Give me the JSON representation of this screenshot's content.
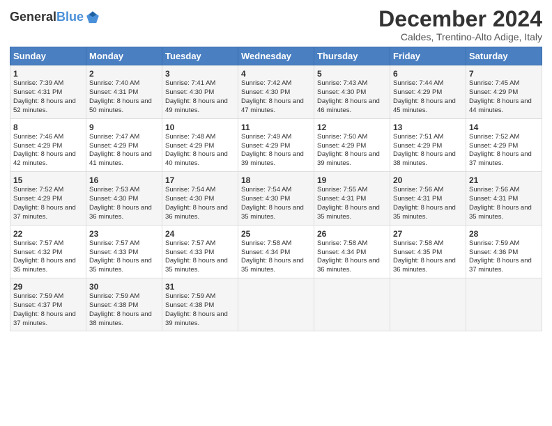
{
  "logo": {
    "line1": "General",
    "line2": "Blue"
  },
  "title": "December 2024",
  "location": "Caldes, Trentino-Alto Adige, Italy",
  "days_header": [
    "Sunday",
    "Monday",
    "Tuesday",
    "Wednesday",
    "Thursday",
    "Friday",
    "Saturday"
  ],
  "weeks": [
    [
      {
        "day": "1",
        "sunrise": "Sunrise: 7:39 AM",
        "sunset": "Sunset: 4:31 PM",
        "daylight": "Daylight: 8 hours and 52 minutes."
      },
      {
        "day": "2",
        "sunrise": "Sunrise: 7:40 AM",
        "sunset": "Sunset: 4:31 PM",
        "daylight": "Daylight: 8 hours and 50 minutes."
      },
      {
        "day": "3",
        "sunrise": "Sunrise: 7:41 AM",
        "sunset": "Sunset: 4:30 PM",
        "daylight": "Daylight: 8 hours and 49 minutes."
      },
      {
        "day": "4",
        "sunrise": "Sunrise: 7:42 AM",
        "sunset": "Sunset: 4:30 PM",
        "daylight": "Daylight: 8 hours and 47 minutes."
      },
      {
        "day": "5",
        "sunrise": "Sunrise: 7:43 AM",
        "sunset": "Sunset: 4:30 PM",
        "daylight": "Daylight: 8 hours and 46 minutes."
      },
      {
        "day": "6",
        "sunrise": "Sunrise: 7:44 AM",
        "sunset": "Sunset: 4:29 PM",
        "daylight": "Daylight: 8 hours and 45 minutes."
      },
      {
        "day": "7",
        "sunrise": "Sunrise: 7:45 AM",
        "sunset": "Sunset: 4:29 PM",
        "daylight": "Daylight: 8 hours and 44 minutes."
      }
    ],
    [
      {
        "day": "8",
        "sunrise": "Sunrise: 7:46 AM",
        "sunset": "Sunset: 4:29 PM",
        "daylight": "Daylight: 8 hours and 42 minutes."
      },
      {
        "day": "9",
        "sunrise": "Sunrise: 7:47 AM",
        "sunset": "Sunset: 4:29 PM",
        "daylight": "Daylight: 8 hours and 41 minutes."
      },
      {
        "day": "10",
        "sunrise": "Sunrise: 7:48 AM",
        "sunset": "Sunset: 4:29 PM",
        "daylight": "Daylight: 8 hours and 40 minutes."
      },
      {
        "day": "11",
        "sunrise": "Sunrise: 7:49 AM",
        "sunset": "Sunset: 4:29 PM",
        "daylight": "Daylight: 8 hours and 39 minutes."
      },
      {
        "day": "12",
        "sunrise": "Sunrise: 7:50 AM",
        "sunset": "Sunset: 4:29 PM",
        "daylight": "Daylight: 8 hours and 39 minutes."
      },
      {
        "day": "13",
        "sunrise": "Sunrise: 7:51 AM",
        "sunset": "Sunset: 4:29 PM",
        "daylight": "Daylight: 8 hours and 38 minutes."
      },
      {
        "day": "14",
        "sunrise": "Sunrise: 7:52 AM",
        "sunset": "Sunset: 4:29 PM",
        "daylight": "Daylight: 8 hours and 37 minutes."
      }
    ],
    [
      {
        "day": "15",
        "sunrise": "Sunrise: 7:52 AM",
        "sunset": "Sunset: 4:29 PM",
        "daylight": "Daylight: 8 hours and 37 minutes."
      },
      {
        "day": "16",
        "sunrise": "Sunrise: 7:53 AM",
        "sunset": "Sunset: 4:30 PM",
        "daylight": "Daylight: 8 hours and 36 minutes."
      },
      {
        "day": "17",
        "sunrise": "Sunrise: 7:54 AM",
        "sunset": "Sunset: 4:30 PM",
        "daylight": "Daylight: 8 hours and 36 minutes."
      },
      {
        "day": "18",
        "sunrise": "Sunrise: 7:54 AM",
        "sunset": "Sunset: 4:30 PM",
        "daylight": "Daylight: 8 hours and 35 minutes."
      },
      {
        "day": "19",
        "sunrise": "Sunrise: 7:55 AM",
        "sunset": "Sunset: 4:31 PM",
        "daylight": "Daylight: 8 hours and 35 minutes."
      },
      {
        "day": "20",
        "sunrise": "Sunrise: 7:56 AM",
        "sunset": "Sunset: 4:31 PM",
        "daylight": "Daylight: 8 hours and 35 minutes."
      },
      {
        "day": "21",
        "sunrise": "Sunrise: 7:56 AM",
        "sunset": "Sunset: 4:31 PM",
        "daylight": "Daylight: 8 hours and 35 minutes."
      }
    ],
    [
      {
        "day": "22",
        "sunrise": "Sunrise: 7:57 AM",
        "sunset": "Sunset: 4:32 PM",
        "daylight": "Daylight: 8 hours and 35 minutes."
      },
      {
        "day": "23",
        "sunrise": "Sunrise: 7:57 AM",
        "sunset": "Sunset: 4:33 PM",
        "daylight": "Daylight: 8 hours and 35 minutes."
      },
      {
        "day": "24",
        "sunrise": "Sunrise: 7:57 AM",
        "sunset": "Sunset: 4:33 PM",
        "daylight": "Daylight: 8 hours and 35 minutes."
      },
      {
        "day": "25",
        "sunrise": "Sunrise: 7:58 AM",
        "sunset": "Sunset: 4:34 PM",
        "daylight": "Daylight: 8 hours and 35 minutes."
      },
      {
        "day": "26",
        "sunrise": "Sunrise: 7:58 AM",
        "sunset": "Sunset: 4:34 PM",
        "daylight": "Daylight: 8 hours and 36 minutes."
      },
      {
        "day": "27",
        "sunrise": "Sunrise: 7:58 AM",
        "sunset": "Sunset: 4:35 PM",
        "daylight": "Daylight: 8 hours and 36 minutes."
      },
      {
        "day": "28",
        "sunrise": "Sunrise: 7:59 AM",
        "sunset": "Sunset: 4:36 PM",
        "daylight": "Daylight: 8 hours and 37 minutes."
      }
    ],
    [
      {
        "day": "29",
        "sunrise": "Sunrise: 7:59 AM",
        "sunset": "Sunset: 4:37 PM",
        "daylight": "Daylight: 8 hours and 37 minutes."
      },
      {
        "day": "30",
        "sunrise": "Sunrise: 7:59 AM",
        "sunset": "Sunset: 4:38 PM",
        "daylight": "Daylight: 8 hours and 38 minutes."
      },
      {
        "day": "31",
        "sunrise": "Sunrise: 7:59 AM",
        "sunset": "Sunset: 4:38 PM",
        "daylight": "Daylight: 8 hours and 39 minutes."
      },
      null,
      null,
      null,
      null
    ]
  ]
}
